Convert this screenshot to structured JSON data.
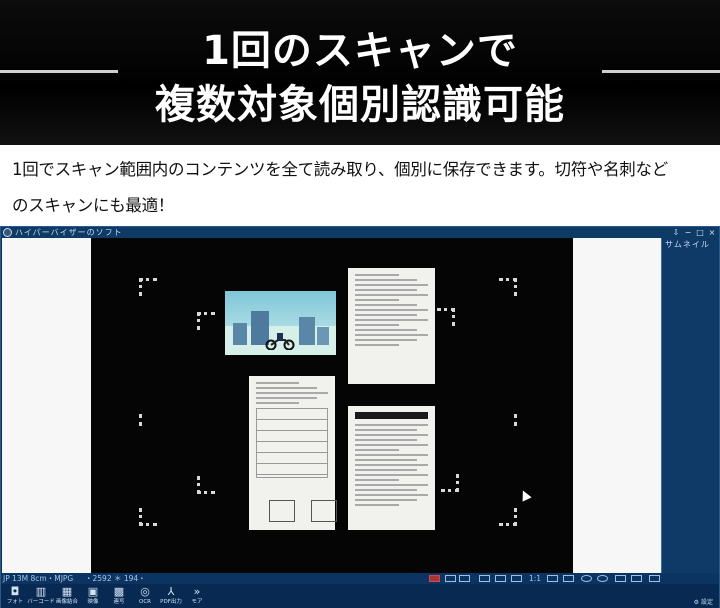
{
  "banner": {
    "title_line1": "1回のスキャンで",
    "title_line2": "複数対象個別認識可能"
  },
  "description": {
    "line1": "1回でスキャン範囲内のコンテンツを全て読み取り、個別に保存できます。切符や名刺など",
    "line2": "のスキャンにも最適！"
  },
  "app": {
    "title": "ハイパーバイザーのソフト",
    "window_controls": [
      "⇩",
      "−",
      "□",
      "×"
    ],
    "side_panel_title": "サムネイル",
    "status": {
      "resolution": "JP 13M 8cm・MJPG",
      "coords": "・2592 ＊ 194・",
      "ratio": "1:1"
    },
    "toolbar": [
      {
        "icon": "camera-icon",
        "glyph": "◘",
        "label": "フォト"
      },
      {
        "icon": "barcode-icon",
        "glyph": "▥",
        "label": "バーコード"
      },
      {
        "icon": "merge-icon",
        "glyph": "▦",
        "label": "画像結合"
      },
      {
        "icon": "video-icon",
        "glyph": "▣",
        "label": "映像"
      },
      {
        "icon": "continuous-icon",
        "glyph": "▩",
        "label": "連写"
      },
      {
        "icon": "ocr-icon",
        "glyph": "◎",
        "label": "OCR"
      },
      {
        "icon": "pdf-icon",
        "glyph": "⅄",
        "label": "PDF出力"
      },
      {
        "icon": "more-icon",
        "glyph": "»",
        "label": "モア"
      }
    ],
    "settings_label": "設定"
  }
}
